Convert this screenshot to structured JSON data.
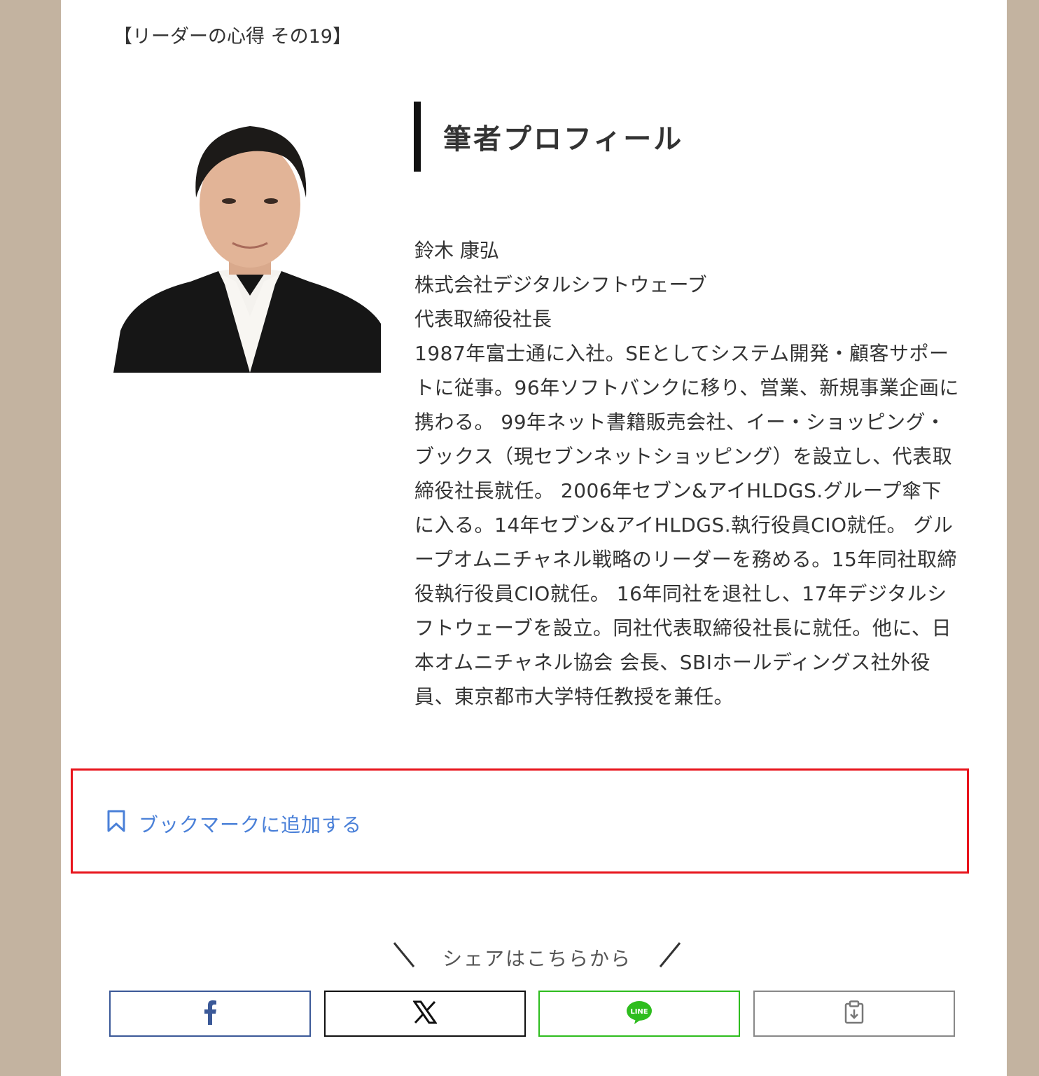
{
  "series_title": "【リーダーの心得 その19】",
  "profile": {
    "heading": "筆者プロフィール",
    "name": "鈴木 康弘",
    "company": "株式会社デジタルシフトウェーブ",
    "position": "代表取締役社長",
    "bio": "1987年富士通に入社。SEとしてシステム開発・顧客サポートに従事。96年ソフトバンクに移り、営業、新規事業企画に携わる。 99年ネット書籍販売会社、イー・ショッピング・ブックス（現セブンネットショッピング）を設立し、代表取締役社長就任。 2006年セブン&アイHLDGS.グループ傘下に入る。14年セブン&アイHLDGS.執行役員CIO就任。 グループオムニチャネル戦略のリーダーを務める。15年同社取締役執行役員CIO就任。 16年同社を退社し、17年デジタルシフトウェーブを設立。同社代表取締役社長に就任。他に、日本オムニチャネル協会 会長、SBIホールディングス社外役員、東京都市大学特任教授を兼任。"
  },
  "bookmark": {
    "label": "ブックマークに追加する",
    "icon": "bookmark-icon"
  },
  "share": {
    "heading": "シェアはこちらから",
    "buttons": [
      {
        "name": "facebook",
        "icon": "facebook-icon",
        "color": "#3b5998"
      },
      {
        "name": "x",
        "icon": "x-icon",
        "color": "#111111"
      },
      {
        "name": "line",
        "icon": "line-icon",
        "color": "#2ebd1e"
      },
      {
        "name": "copy",
        "icon": "clipboard-icon",
        "color": "#888888"
      }
    ]
  },
  "colors": {
    "background": "#c3b3a0",
    "highlight_border": "#e8141c",
    "link": "#4a80d8"
  }
}
